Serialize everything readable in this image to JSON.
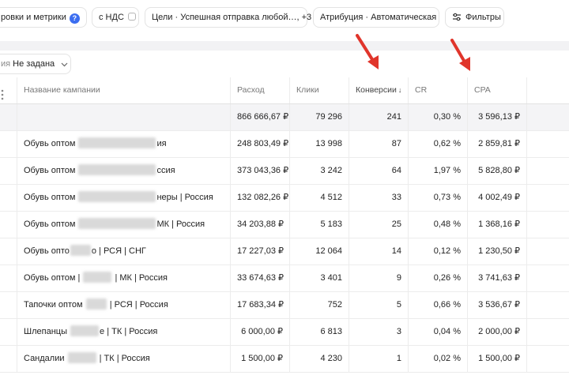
{
  "filters": {
    "grouping_label": "ровки и метрики",
    "help_icon": "?",
    "vat_label": "с НДС",
    "goals_label": "Цели · Успешная отправка любой…, +3",
    "attribution_label": "Атрибуция · Автоматическая",
    "filters_label": "Фильтры"
  },
  "grouping": {
    "label": "ия",
    "value": "Не задана"
  },
  "table": {
    "columns": [
      "Название кампании",
      "Расход",
      "Клики",
      "Конверсии",
      "CR",
      "CPA"
    ],
    "sort_indicator": "↓",
    "total": {
      "spend": "866 666,67 ₽",
      "clicks": "79 296",
      "conversions": "241",
      "cr": "0,30 %",
      "cpa": "3 596,13 ₽"
    },
    "rows": [
      {
        "name_start": "Обувь оптом",
        "name_end": "ия",
        "spend": "248 803,49 ₽",
        "clicks": "13 998",
        "conversions": "87",
        "cr": "0,62 %",
        "cpa": "2 859,81 ₽"
      },
      {
        "name_start": "Обувь оптом",
        "name_end": "ссия",
        "spend": "373 043,36 ₽",
        "clicks": "3 242",
        "conversions": "64",
        "cr": "1,97 %",
        "cpa": "5 828,80 ₽"
      },
      {
        "name_start": "Обувь оптом",
        "name_end": "неры | Россия",
        "spend": "132 082,26 ₽",
        "clicks": "4 512",
        "conversions": "33",
        "cr": "0,73 %",
        "cpa": "4 002,49 ₽"
      },
      {
        "name_start": "Обувь оптом",
        "name_end": "МК | Россия",
        "spend": "34 203,88 ₽",
        "clicks": "5 183",
        "conversions": "25",
        "cr": "0,48 %",
        "cpa": "1 368,16 ₽"
      },
      {
        "name_start": "Обувь опто",
        "name_end": "о | РСЯ | СНГ",
        "spend": "17 227,03 ₽",
        "clicks": "12 064",
        "conversions": "14",
        "cr": "0,12 %",
        "cpa": "1 230,50 ₽"
      },
      {
        "name_start": "Обувь оптом |",
        "name_end": "| МК | Россия",
        "spend": "33 674,63 ₽",
        "clicks": "3 401",
        "conversions": "9",
        "cr": "0,26 %",
        "cpa": "3 741,63 ₽"
      },
      {
        "name_start": "Тапочки оптом",
        "name_end": "| РСЯ | Россия",
        "spend": "17 683,34 ₽",
        "clicks": "752",
        "conversions": "5",
        "cr": "0,66 %",
        "cpa": "3 536,67 ₽"
      },
      {
        "name_start": "Шлепанцы",
        "name_end": "е | ТК | Россия",
        "spend": "6 000,00 ₽",
        "clicks": "6 813",
        "conversions": "3",
        "cr": "0,04 %",
        "cpa": "2 000,00 ₽"
      },
      {
        "name_start": "Сандалии",
        "name_end": "| ТК | Россия",
        "spend": "1 500,00 ₽",
        "clicks": "4 230",
        "conversions": "1",
        "cr": "0,02 %",
        "cpa": "1 500,00 ₽"
      }
    ]
  },
  "colors": {
    "annotation_arrow": "#e0352b",
    "help_badge": "#3b6df0",
    "total_row_bg": "#f4f4f6"
  },
  "icons": [
    "help-icon",
    "vat-toggle-icon",
    "filter-icon",
    "chevron-down-icon",
    "column-menu-icon",
    "annotation-arrow-icon"
  ]
}
